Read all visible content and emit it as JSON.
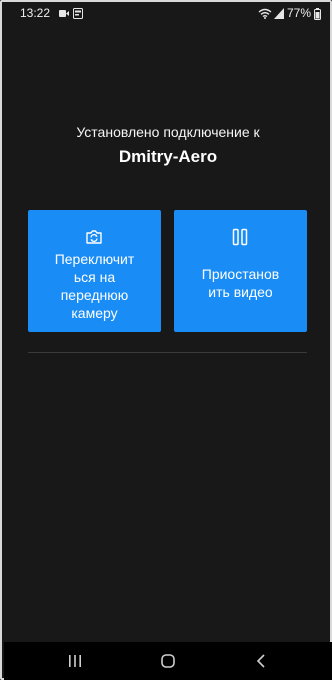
{
  "status_bar": {
    "time": "13:22",
    "battery": "77%"
  },
  "connection": {
    "title": "Установлено подключение к",
    "device": "Dmitry-Aero"
  },
  "buttons": {
    "switch_camera": {
      "lines": [
        "Переключит",
        "ься на",
        "переднюю",
        "камеру"
      ],
      "icon": "switch-camera-icon"
    },
    "pause_video": {
      "lines": [
        "Приостанов",
        "ить видео"
      ],
      "icon": "pause-icon"
    }
  },
  "colors": {
    "background": "#181818",
    "button": "#1a8cf5",
    "text": "#ffffff"
  }
}
